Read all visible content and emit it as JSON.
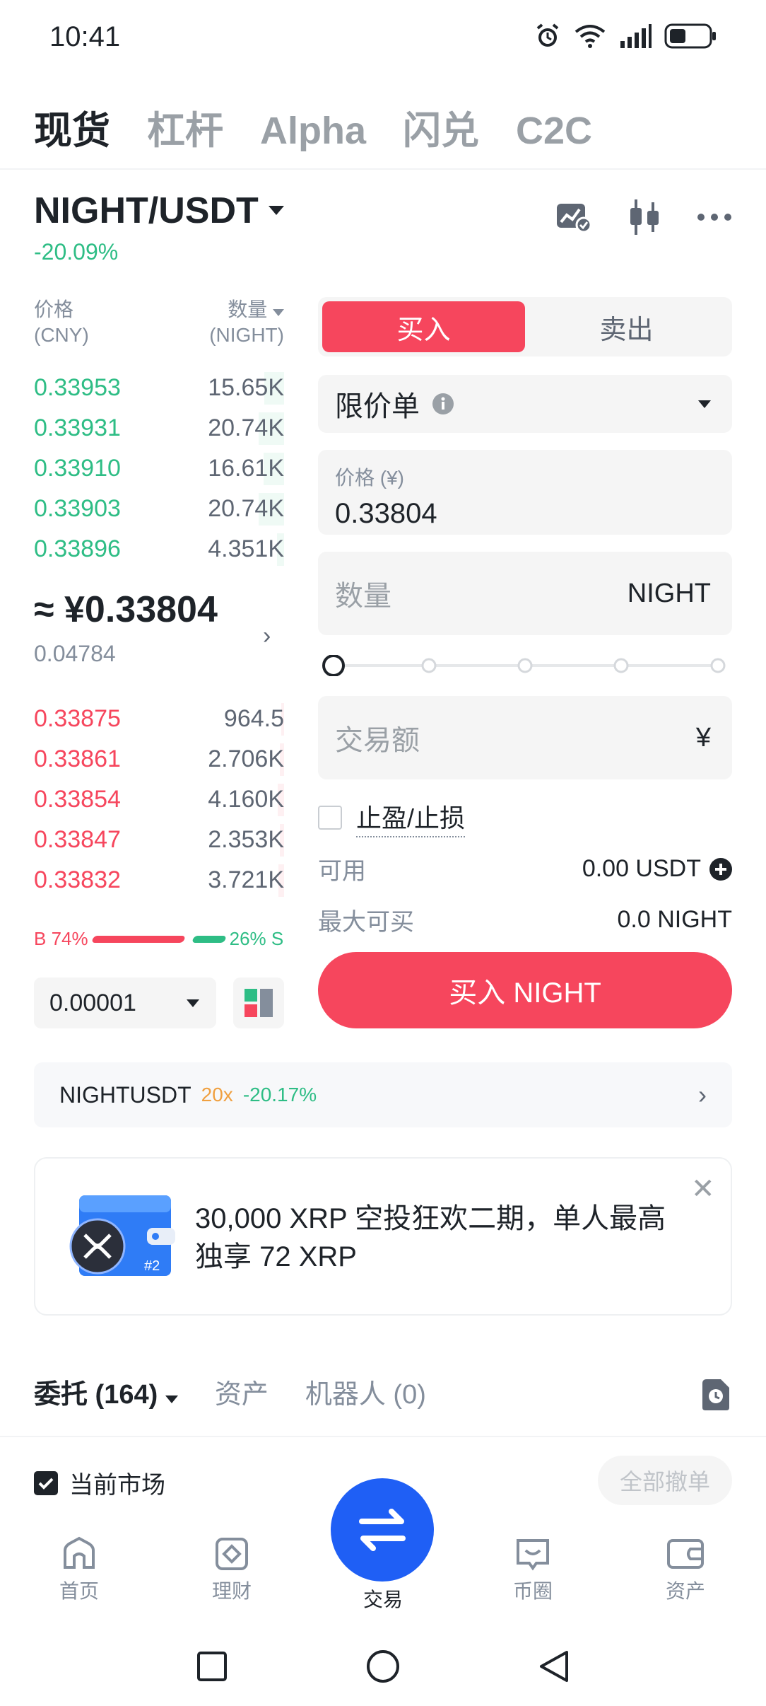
{
  "status_bar": {
    "time": "10:41",
    "battery_icon": "battery-icon",
    "signal_icon": "signal-icon",
    "wifi_icon": "wifi-icon",
    "alarm_icon": "alarm-icon"
  },
  "top_tabs": [
    {
      "label": "现货",
      "active": true
    },
    {
      "label": "杠杆",
      "active": false
    },
    {
      "label": "Alpha",
      "active": false
    },
    {
      "label": "闪兑",
      "active": false
    },
    {
      "label": "C2C",
      "active": false
    }
  ],
  "pair": {
    "name": "NIGHT/USDT",
    "change": "-20.09%"
  },
  "order_book": {
    "price_header": "价格",
    "price_unit": "(CNY)",
    "qty_header": "数量",
    "qty_unit": "(NIGHT)",
    "bids": [
      {
        "price": "0.33953",
        "qty": "15.65K",
        "depth": 0.35
      },
      {
        "price": "0.33931",
        "qty": "20.74K",
        "depth": 0.45
      },
      {
        "price": "0.33910",
        "qty": "16.61K",
        "depth": 0.36
      },
      {
        "price": "0.33903",
        "qty": "20.74K",
        "depth": 0.45
      },
      {
        "price": "0.33896",
        "qty": "4.351K",
        "depth": 0.12
      }
    ],
    "mid_price": "≈ ¥0.33804",
    "mid_sub": "0.04784",
    "asks": [
      {
        "price": "0.33875",
        "qty": "964.5",
        "depth": 0.05
      },
      {
        "price": "0.33861",
        "qty": "2.706K",
        "depth": 0.08
      },
      {
        "price": "0.33854",
        "qty": "4.160K",
        "depth": 0.11
      },
      {
        "price": "0.33847",
        "qty": "2.353K",
        "depth": 0.07
      },
      {
        "price": "0.33832",
        "qty": "3.721K",
        "depth": 0.1
      }
    ],
    "ratio": {
      "buy_label": "B 74%",
      "sell_label": "26% S",
      "buy_pct": 74,
      "sell_pct": 26
    },
    "tick_size": "0.00001"
  },
  "form": {
    "buy_label": "买入",
    "sell_label": "卖出",
    "order_type": "限价单",
    "price_label": "价格 (¥)",
    "price_value": "0.33804",
    "qty_placeholder": "数量",
    "qty_unit": "NIGHT",
    "amount_placeholder": "交易额",
    "amount_unit": "¥",
    "tpsl_label": "止盈/止损",
    "available_label": "可用",
    "available_value": "0.00 USDT",
    "max_buy_label": "最大可买",
    "max_buy_value": "0.0 NIGHT",
    "submit_label": "买入 NIGHT"
  },
  "futures": {
    "symbol": "NIGHTUSDT",
    "leverage": "20x",
    "change": "-20.17%"
  },
  "banner": {
    "text": "30,000 XRP 空投狂欢二期，单人最高独享 72 XRP",
    "badge": "#2"
  },
  "order_tabs": {
    "orders": "委托 (164)",
    "assets": "资产",
    "bots": "机器人 (0)",
    "current_market": "当前市场",
    "cancel_all": "全部撤单"
  },
  "bottom_nav": [
    {
      "label": "首页",
      "icon": "home-icon"
    },
    {
      "label": "理财",
      "icon": "finance-icon"
    },
    {
      "label": "交易",
      "icon": "trade-swap-icon",
      "active": true
    },
    {
      "label": "币圈",
      "icon": "chat-icon"
    },
    {
      "label": "资产",
      "icon": "wallet-icon"
    }
  ],
  "colors": {
    "bid": "#2ebd85",
    "ask": "#f6465d",
    "primary": "#1f5ff5"
  }
}
